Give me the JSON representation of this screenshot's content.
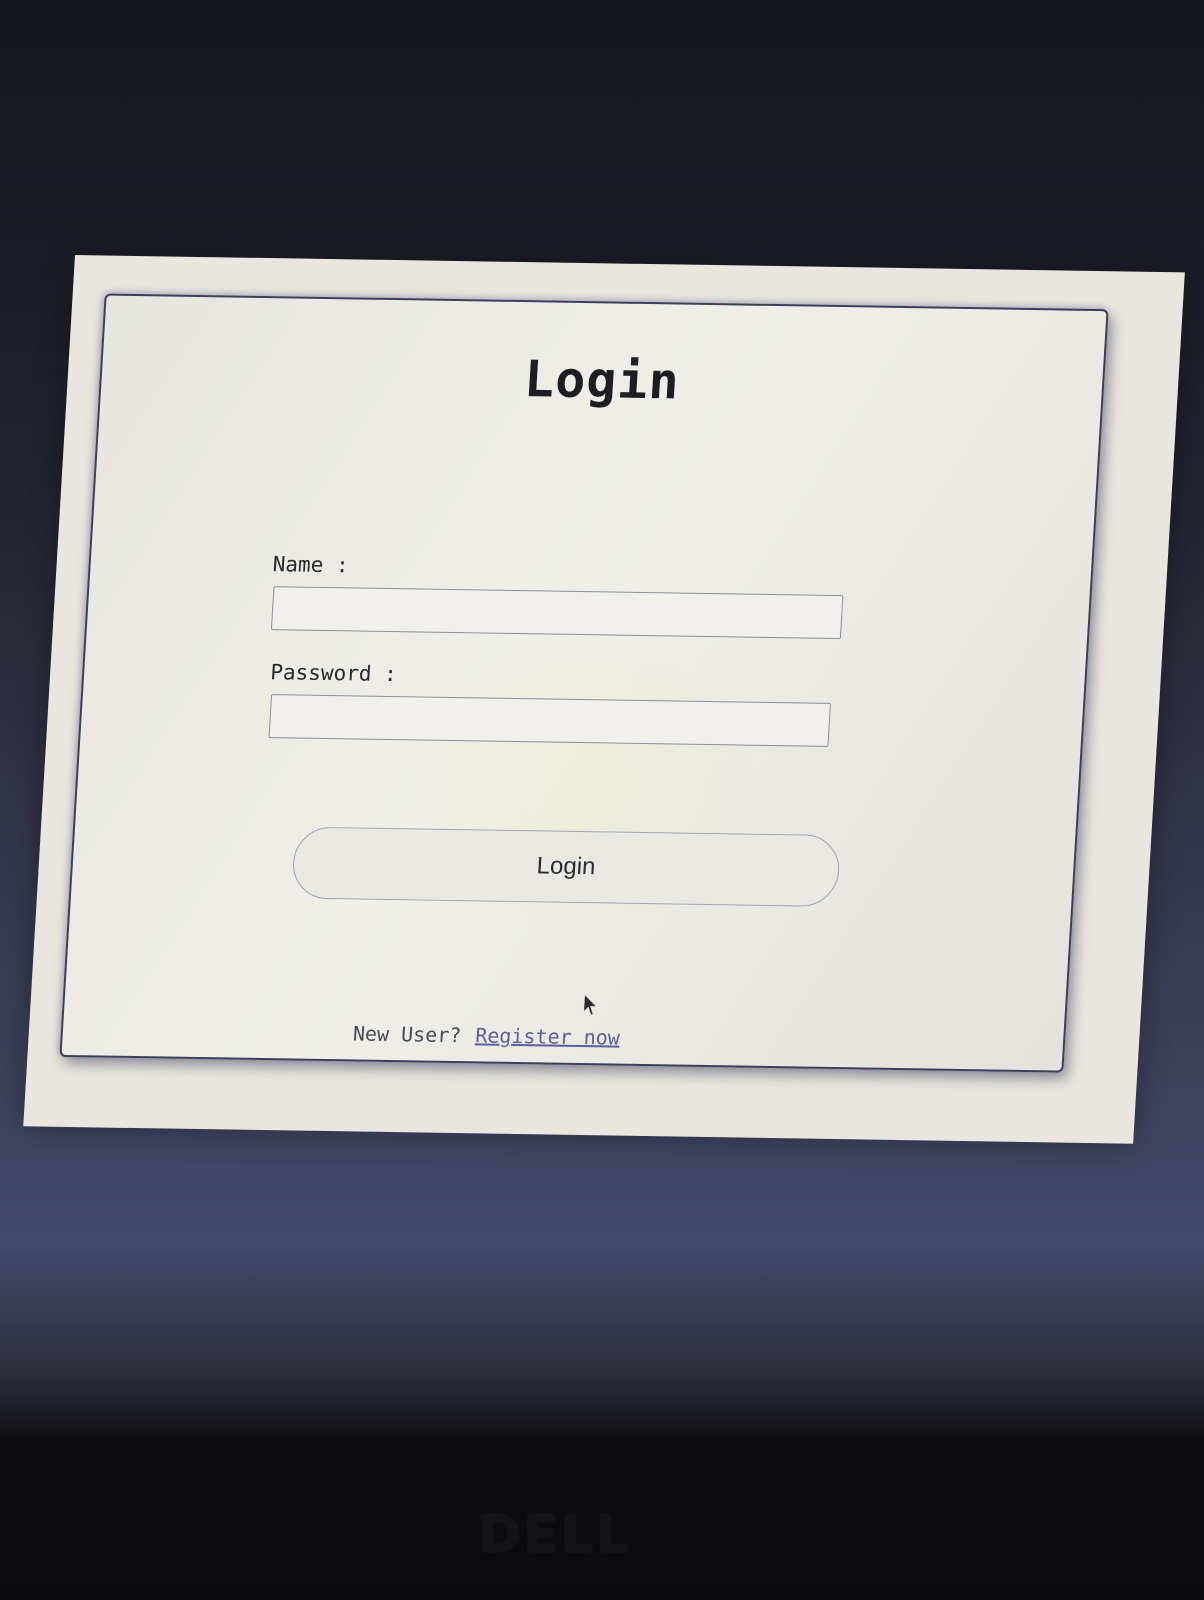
{
  "login_form": {
    "title": "Login",
    "name_label": "Name :",
    "name_value": "",
    "password_label": "Password :",
    "password_value": "",
    "submit_label": "Login",
    "footer_text": "New User?",
    "register_link": "Register now"
  },
  "monitor": {
    "brand": "DELL"
  },
  "colors": {
    "card_background": "#e8e6de",
    "card_border": "#3c3f58",
    "link": "#5b5f9a",
    "text": "#1e1e22"
  },
  "icons": {
    "cursor": "mouse-pointer-icon"
  }
}
